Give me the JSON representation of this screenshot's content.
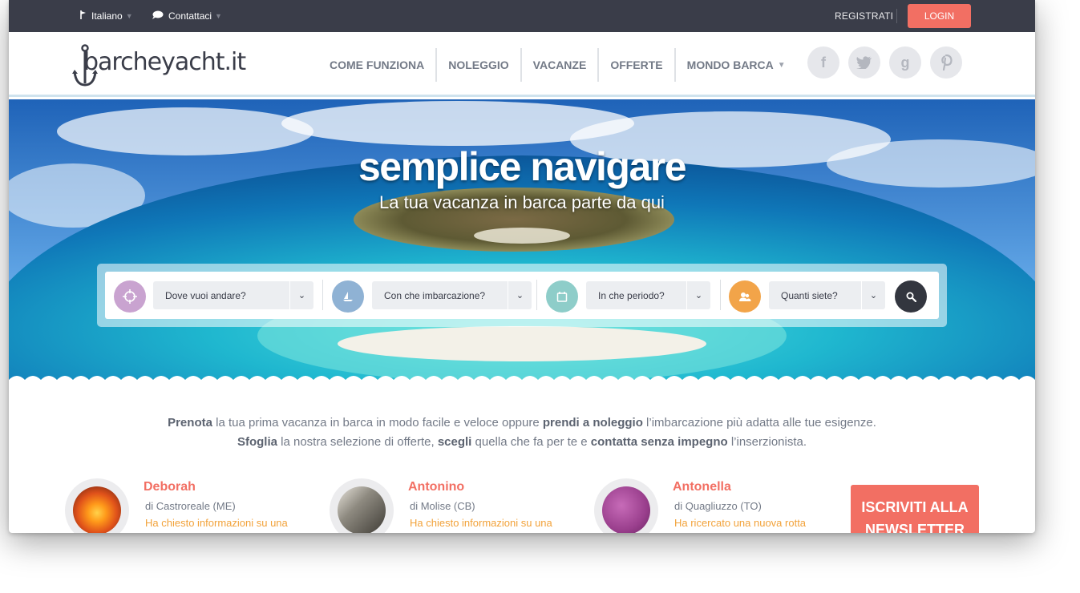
{
  "topbar": {
    "language": "Italiano",
    "contact": "Contattaci",
    "register": "REGISTRATI",
    "login": "LOGIN"
  },
  "logo": {
    "text": "barcheyacht.it"
  },
  "nav": {
    "items": [
      "COME FUNZIONA",
      "NOLEGGIO",
      "VACANZE",
      "OFFERTE",
      "MONDO BARCA"
    ]
  },
  "social": {
    "facebook": "f",
    "google": "g"
  },
  "hero": {
    "title": "semplice navigare",
    "subtitle": "La tua vacanza in barca parte da qui"
  },
  "search": {
    "destination": "Dove vuoi andare?",
    "boat": "Con che imbarcazione?",
    "period": "In che periodo?",
    "people": "Quanti siete?",
    "icons": {
      "destination": "compass-icon",
      "boat": "sailboat-icon",
      "period": "calendar-icon",
      "people": "people-icon",
      "submit": "search-icon"
    },
    "colors": {
      "destination": "#c9a3d0",
      "boat": "#8fb2d4",
      "period": "#8ecdc9",
      "people": "#f2a449",
      "submit": "#33363f"
    }
  },
  "intro": {
    "l1_b1": "Prenota",
    "l1_t1": " la tua prima vacanza in barca in modo facile e veloce oppure ",
    "l1_b2": "prendi a noleggio",
    "l1_t2": " l’imbarcazione più adatta alle tue esigenze.",
    "l2_b1": "Sfoglia",
    "l2_t1": " la nostra selezione di offerte, ",
    "l2_b2": "scegli",
    "l2_t2": " quella che fa per te e ",
    "l2_b3": "contatta senza impegno",
    "l2_t3": " l’inserzionista."
  },
  "testimonials": [
    {
      "name": "Deborah",
      "place": "di Castroreale (ME)",
      "action": "Ha chiesto informazioni su una"
    },
    {
      "name": "Antonino",
      "place": "di Molise (CB)",
      "action": "Ha chiesto informazioni su una"
    },
    {
      "name": "Antonella",
      "place": "di Quagliuzzo (TO)",
      "action": "Ha ricercato una nuova rotta"
    }
  ],
  "newsletter": {
    "line1": "ISCRIVITI ALLA",
    "line2": "NEWSLETTER"
  },
  "colors": {
    "accent": "#f26f63",
    "dark": "#3a3d49",
    "orange": "#f2a23a"
  }
}
